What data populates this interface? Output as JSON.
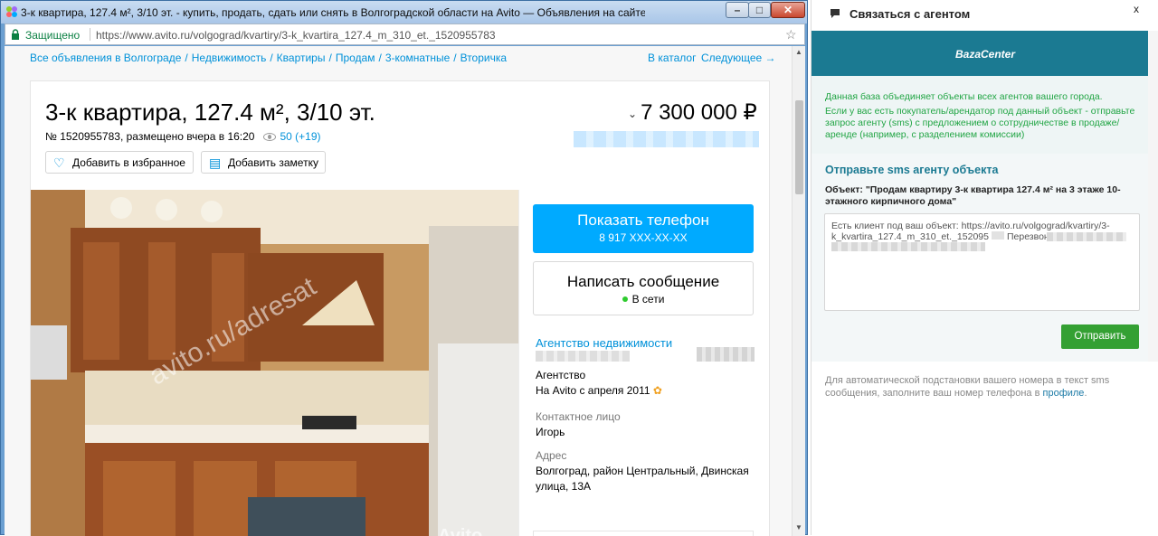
{
  "window": {
    "title": "3-к квартира, 127.4 м², 3/10 эт. - купить, продать, сдать или снять в Волгоградской области на Avito — Объявления на сайте Avito - Google Chrome",
    "min_label": "–",
    "max_label": "□",
    "close_label": "✕"
  },
  "address_bar": {
    "secure_label": "Защищено",
    "url_prefix": "https://www.avito.ru",
    "url_path": "/volgograd/kvartiry/3-k_kvartira_127.4_m_310_et._1520955783"
  },
  "breadcrumbs": [
    "Все объявления в Волгограде",
    "Недвижимость",
    "Квартиры",
    "Продам",
    "3-комнатные",
    "Вторичка"
  ],
  "nav": {
    "catalog": "В каталог",
    "next": "Следующее →"
  },
  "listing": {
    "title": "3-к квартира, 127.4 м², 3/10 эт.",
    "meta": "№ 1520955783, размещено вчера в 16:20",
    "views": "50 (+19)",
    "price": "7 300 000 ₽",
    "fav_button": "Добавить в избранное",
    "note_button": "Добавить заметку",
    "watermark": "avito.ru/adresat",
    "photo_logo": "Avito"
  },
  "contact": {
    "phone_button": "Показать телефон",
    "phone_masked": "8 917 XXX-XX-XX",
    "message_button": "Написать сообщение",
    "online": "В сети",
    "agency": "Агентство недвижимости",
    "seller_type": "Агентство",
    "since": "На Avito с апреля 2011",
    "contact_label": "Контактное лицо",
    "contact_name": "Игорь",
    "address_label": "Адрес",
    "address_value_1": "Волгоград, район Центральный, Двинская",
    "address_value_2": "улица, 13А"
  },
  "panel": {
    "header": "Связаться с агентом",
    "close": "x",
    "brand": "BazaCenter",
    "info_1": "Данная база объединяет объекты всех агентов вашего города.",
    "info_2": "Если у вас есть покупатель/арендатор под данный объект - отправьте запрос агенту (sms) с предложением о сотрудничестве в продаже/аренде (например, с разделением комиссии)",
    "sms_heading": "Отправьте sms агенту объекта",
    "object_text": "Объект: \"Продам квартиру 3-к квартира 127.4 м² на 3 этаже 10-этажного кирпичного дома\"",
    "sms_line_1": "Есть клиент под ваш объект: https://avito.ru/volgograd/kvartiry/3-",
    "sms_line_2": "k_kvartira_127.4_m_310_et._152095",
    "sms_line_2b": "Перезвоните: \"",
    "send_button": "Отправить",
    "footer_text": "Для автоматической подстановки вашего номера в текст sms сообщения, заполните ваш номер телефона в ",
    "footer_link": "профиле",
    "footer_end": "."
  },
  "colors": {
    "link": "#0091d9",
    "phone_button": "#00aaff",
    "panel_brand": "#1b7a92",
    "panel_info_text": "#21a544",
    "send_button": "#34a033"
  }
}
